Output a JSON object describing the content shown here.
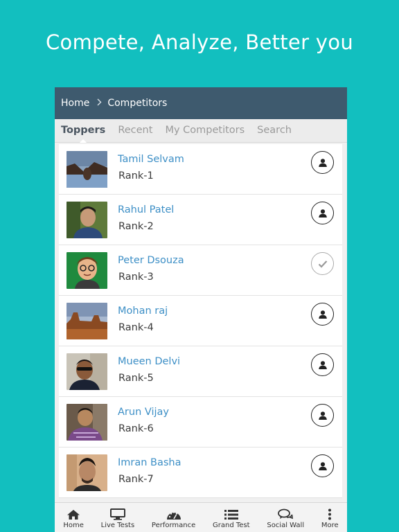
{
  "headline": "Compete, Analyze, Better you",
  "breadcrumb": {
    "home": "Home",
    "separator": ">",
    "current": "Competitors"
  },
  "tabs": [
    {
      "label": "Toppers",
      "active": true
    },
    {
      "label": "Recent",
      "active": false
    },
    {
      "label": "My Competitors",
      "active": false
    },
    {
      "label": "Search",
      "active": false
    }
  ],
  "competitors": [
    {
      "name": "Tamil Selvam",
      "rank": "Rank-1",
      "status": "add",
      "icon": "user-icon"
    },
    {
      "name": "Rahul Patel",
      "rank": "Rank-2",
      "status": "add",
      "icon": "user-icon"
    },
    {
      "name": "Peter Dsouza",
      "rank": "Rank-3",
      "status": "added",
      "icon": "check-icon"
    },
    {
      "name": "Mohan raj",
      "rank": "Rank-4",
      "status": "add",
      "icon": "user-icon"
    },
    {
      "name": "Mueen Delvi",
      "rank": "Rank-5",
      "status": "add",
      "icon": "user-icon"
    },
    {
      "name": "Arun Vijay",
      "rank": "Rank-6",
      "status": "add",
      "icon": "user-icon"
    },
    {
      "name": "Imran Basha",
      "rank": "Rank-7",
      "status": "add",
      "icon": "user-icon"
    }
  ],
  "bottom_nav": [
    {
      "label": "Home",
      "icon": "home-icon"
    },
    {
      "label": "Live Tests",
      "icon": "monitor-icon"
    },
    {
      "label": "Performance",
      "icon": "gauge-icon"
    },
    {
      "label": "Grand Test",
      "icon": "list-icon"
    },
    {
      "label": "Social Wall",
      "icon": "chat-icon"
    },
    {
      "label": "More",
      "icon": "more-vertical-icon"
    }
  ],
  "colors": {
    "background": "#12bfbf",
    "header_bar": "#3e5a6e",
    "name_link": "#3d8fc6"
  }
}
